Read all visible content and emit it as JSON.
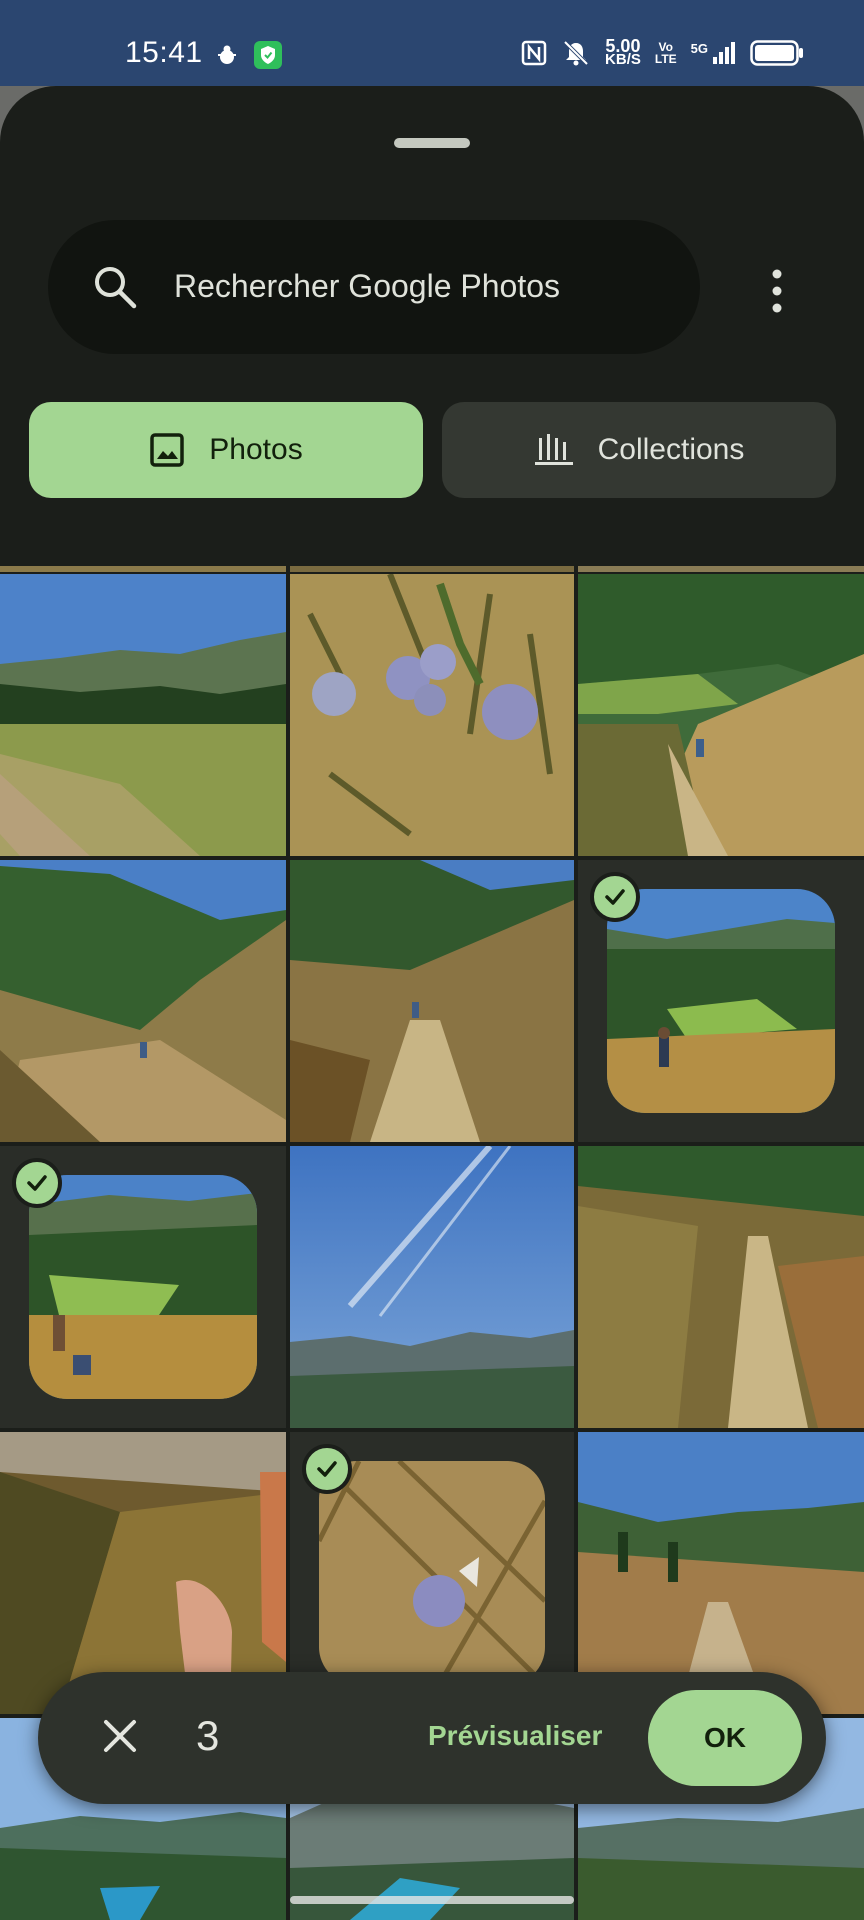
{
  "status_bar": {
    "time": "15:41",
    "speed_value": "5.00",
    "speed_unit": "KB/S",
    "volte_top": "Vo",
    "volte_bottom": "LTE",
    "network": "5G",
    "icons": [
      "beetle-icon",
      "shield-icon",
      "nfc-icon",
      "mute-icon",
      "signal-icon",
      "battery-icon"
    ]
  },
  "search": {
    "placeholder": "Rechercher Google Photos"
  },
  "tabs": [
    {
      "label": "Photos",
      "icon": "image-icon",
      "selected": true
    },
    {
      "label": "Collections",
      "icon": "library-icon",
      "selected": false
    }
  ],
  "photos": [
    {
      "subject": "meadow-valley",
      "selected": false
    },
    {
      "subject": "thistle-flowers",
      "selected": false
    },
    {
      "subject": "hiker-trail-green-valley",
      "selected": false
    },
    {
      "subject": "hillside-trail",
      "selected": false
    },
    {
      "subject": "hiker-on-path",
      "selected": false
    },
    {
      "subject": "hikers-valley",
      "selected": true
    },
    {
      "subject": "hikers-on-rocks",
      "selected": true
    },
    {
      "subject": "sky-sun-mountains",
      "selected": false
    },
    {
      "subject": "dirt-trail-bushes",
      "selected": false
    },
    {
      "subject": "grass-finger-closeup",
      "selected": false
    },
    {
      "subject": "thistle-closeup",
      "selected": true
    },
    {
      "subject": "mountain-trail",
      "selected": false
    },
    {
      "subject": "lake-valley-1",
      "selected": false
    },
    {
      "subject": "lake-valley-2",
      "selected": false
    },
    {
      "subject": "lake-valley-3",
      "selected": false
    }
  ],
  "selection_bar": {
    "count": "3",
    "preview_label": "Prévisualiser",
    "ok_label": "OK"
  },
  "colors": {
    "accent": "#a3d692",
    "surface": "#1b1e1a",
    "status_bar": "#2b4670"
  }
}
